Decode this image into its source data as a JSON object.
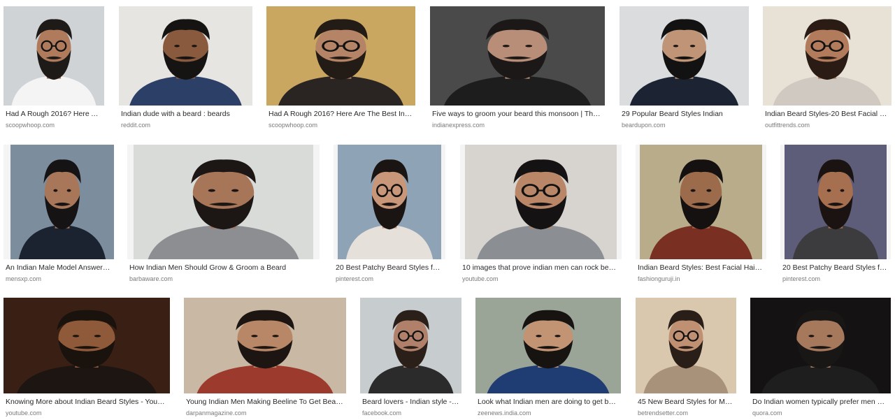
{
  "results": [
    {
      "title": "Had A Rough 2016? Here Ar…",
      "source": "scoopwhoop.com",
      "bg": "#cfd3d6",
      "skin": "#b07a5c",
      "hair": "#1e1a18",
      "shirt": "#f4f4f4",
      "glasses": true
    },
    {
      "title": "Indian dude with a beard : beards",
      "source": "reddit.com",
      "bg": "#e7e5e1",
      "skin": "#8a5a3e",
      "hair": "#161413",
      "shirt": "#2c3f66",
      "glasses": false
    },
    {
      "title": "Had A Rough 2016? Here Are The Best India…",
      "source": "scoopwhoop.com",
      "bg": "#c9a761",
      "skin": "#b58466",
      "hair": "#231b15",
      "shirt": "#2a2522",
      "glasses": true
    },
    {
      "title": "Five ways to groom your beard this monsoon | The In…",
      "source": "indianexpress.com",
      "bg": "#4a4a4a",
      "skin": "#b98e78",
      "hair": "#1b1817",
      "shirt": "#1d1d1d",
      "glasses": false
    },
    {
      "title": "29 Popular Beard Styles Indian",
      "source": "beardupon.com",
      "bg": "#dadcde",
      "skin": "#c09476",
      "hair": "#131212",
      "shirt": "#1c2333",
      "glasses": false
    },
    {
      "title": "Indian Beard Styles-20 Best Facial Hai…",
      "source": "outfittrends.com",
      "bg": "#e8e2d6",
      "skin": "#b27b5b",
      "hair": "#2a1c14",
      "shirt": "#cfc9c2",
      "glasses": true
    },
    {
      "title": "An Indian Male Model Answers 1…",
      "source": "mensxp.com",
      "bg": "#7c8d9e",
      "skin": "#a8775a",
      "hair": "#151313",
      "shirt": "#1b2230",
      "glasses": false
    },
    {
      "title": "How Indian Men Should Grow & Groom a Beard",
      "source": "barbaware.com",
      "bg": "#d8dbd7",
      "skin": "#a77558",
      "hair": "#1c1614",
      "shirt": "#8c8e92",
      "glasses": false
    },
    {
      "title": "20 Best Patchy Beard Styles for …",
      "source": "pinterest.com",
      "bg": "#8ea3b6",
      "skin": "#c8977a",
      "hair": "#1a1512",
      "shirt": "#e6e0da",
      "glasses": true
    },
    {
      "title": "10 images that prove indian men can rock beard …",
      "source": "youtube.com",
      "bg": "#d7d4cf",
      "skin": "#b98768",
      "hair": "#141212",
      "shirt": "#8b8e93",
      "glasses": true
    },
    {
      "title": "Indian Beard Styles: Best Facial Hairsty…",
      "source": "fashionguruji.in",
      "bg": "#b8ac8a",
      "skin": "#9c6b4c",
      "hair": "#141110",
      "shirt": "#7a2f23",
      "glasses": false
    },
    {
      "title": "20 Best Patchy Beard Styles for …",
      "source": "pinterest.com",
      "bg": "#5d5d7a",
      "skin": "#a66f50",
      "hair": "#1a1311",
      "shirt": "#3c3c3e",
      "glasses": false
    },
    {
      "title": "Knowing More about Indian Beard Styles - YouTube",
      "source": "youtube.com",
      "bg": "#3a2014",
      "skin": "#8f5a3a",
      "hair": "#1a120d",
      "shirt": "#1c1512",
      "glasses": false
    },
    {
      "title": "Young Indian Men Making Beeline To Get Beard I…",
      "source": "darpanmagazine.com",
      "bg": "#c9b9a4",
      "skin": "#b88768",
      "hair": "#1c1511",
      "shirt": "#9c3a2e",
      "glasses": false
    },
    {
      "title": "Beard lovers - Indian style - …",
      "source": "facebook.com",
      "bg": "#c7cccf",
      "skin": "#b0806a",
      "hair": "#2a2019",
      "shirt": "#2b2b2b",
      "glasses": true
    },
    {
      "title": "Look what Indian men are doing to get bear…",
      "source": "zeenews.india.com",
      "bg": "#9aa598",
      "skin": "#c39474",
      "hair": "#161311",
      "shirt": "#1f3d72",
      "glasses": false
    },
    {
      "title": "45 New Beard Styles for Men…",
      "source": "betrendsetter.com",
      "bg": "#d9c8ae",
      "skin": "#c09072",
      "hair": "#2a1f18",
      "shirt": "#a8927a",
      "glasses": true
    },
    {
      "title": "Do Indian women typically prefer men wit…",
      "source": "quora.com",
      "bg": "#141212",
      "skin": "#a7795c",
      "hair": "#191616",
      "shirt": "#1f1e1e",
      "glasses": false
    }
  ]
}
